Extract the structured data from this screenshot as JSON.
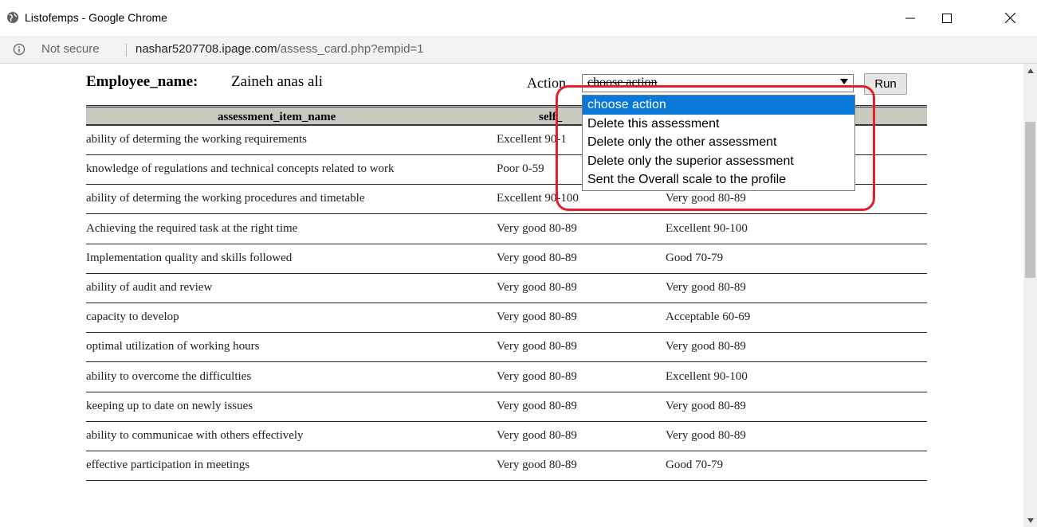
{
  "window": {
    "title": "Listofemps - Google Chrome",
    "not_secure": "Not secure",
    "url_host": "nashar5207708.ipage.com",
    "url_path": "/assess_card.php?empid=1"
  },
  "employee": {
    "label": "Employee_name:",
    "value": "Zaineh anas ali"
  },
  "action": {
    "label": "Action",
    "selected": "choose action",
    "run_label": "Run",
    "options": [
      "choose action",
      "Delete this assessment",
      "Delete only the other assessment",
      "Delete only the superior assessment",
      "Sent the Overall scale to the profile"
    ]
  },
  "table": {
    "headers": [
      "assessment_item_name",
      "self_",
      ""
    ],
    "rows": [
      [
        "ability of determing the working requirements",
        "Excellent 90-1",
        ""
      ],
      [
        "knowledge of regulations and technical concepts related to work",
        "Poor 0-59",
        ""
      ],
      [
        "ability of determing the working procedures and timetable",
        "Excellent 90-100",
        "Very good 80-89"
      ],
      [
        "Achieving the required task at the right time",
        "Very good 80-89",
        "Excellent 90-100"
      ],
      [
        "Implementation quality and skills followed",
        "Very good 80-89",
        "Good 70-79"
      ],
      [
        "ability of audit and review",
        "Very good 80-89",
        "Very good 80-89"
      ],
      [
        "capacity to develop",
        "Very good 80-89",
        "Acceptable 60-69"
      ],
      [
        "optimal utilization of working hours",
        "Very good 80-89",
        "Very good 80-89"
      ],
      [
        "ability to overcome the difficulties",
        "Very good 80-89",
        "Excellent 90-100"
      ],
      [
        "keeping up to date on newly issues",
        "Very good 80-89",
        "Very good 80-89"
      ],
      [
        "ability to communicae with others effectively",
        "Very good 80-89",
        "Very good 80-89"
      ],
      [
        "effective participation in meetings",
        "Very good 80-89",
        "Good 70-79"
      ]
    ]
  },
  "colors": {
    "highlight": "#e3202a",
    "selected_option": "#0a78d7",
    "header_bg": "#c9c9c0"
  }
}
